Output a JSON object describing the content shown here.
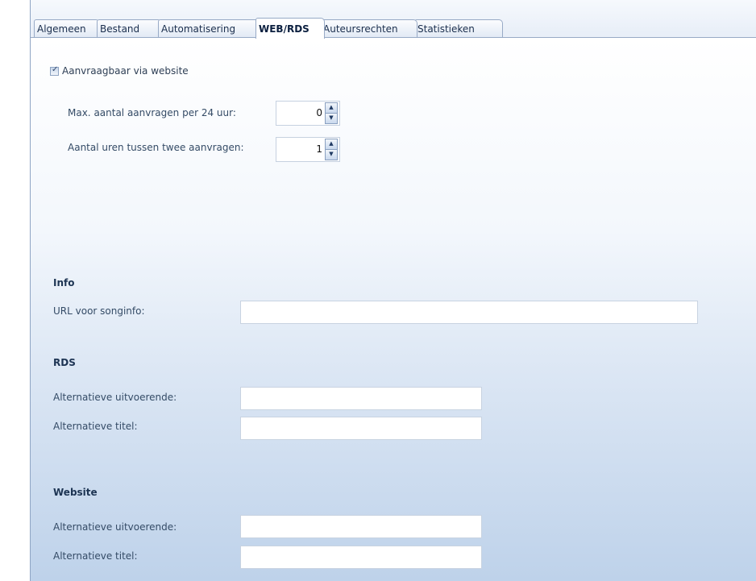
{
  "tabs": [
    {
      "label": "Algemeen",
      "active": false
    },
    {
      "label": "Bestand",
      "active": false
    },
    {
      "label": "Automatisering",
      "active": false
    },
    {
      "label": "WEB/RDS",
      "active": true
    },
    {
      "label": "Auteursrechten",
      "active": false
    },
    {
      "label": "Statistieken",
      "active": false
    }
  ],
  "web": {
    "requestable_label": "Aanvraagbaar via website",
    "requestable_checked": true,
    "max_requests_label": "Max. aantal aanvragen per 24 uur:",
    "max_requests_value": "0",
    "hours_between_label": "Aantal uren tussen twee aanvragen:",
    "hours_between_value": "1"
  },
  "info": {
    "title": "Info",
    "url_label": "URL voor songinfo:",
    "url_value": ""
  },
  "rds": {
    "title": "RDS",
    "artist_label": "Alternatieve uitvoerende:",
    "artist_value": "",
    "title_label": "Alternatieve titel:",
    "title_value": ""
  },
  "website": {
    "title": "Website",
    "artist_label": "Alternatieve uitvoerende:",
    "artist_value": "",
    "title_label": "Alternatieve titel:",
    "title_value": ""
  },
  "icons": {
    "spin_up": "▲",
    "spin_down": "▼",
    "check": "✓"
  }
}
